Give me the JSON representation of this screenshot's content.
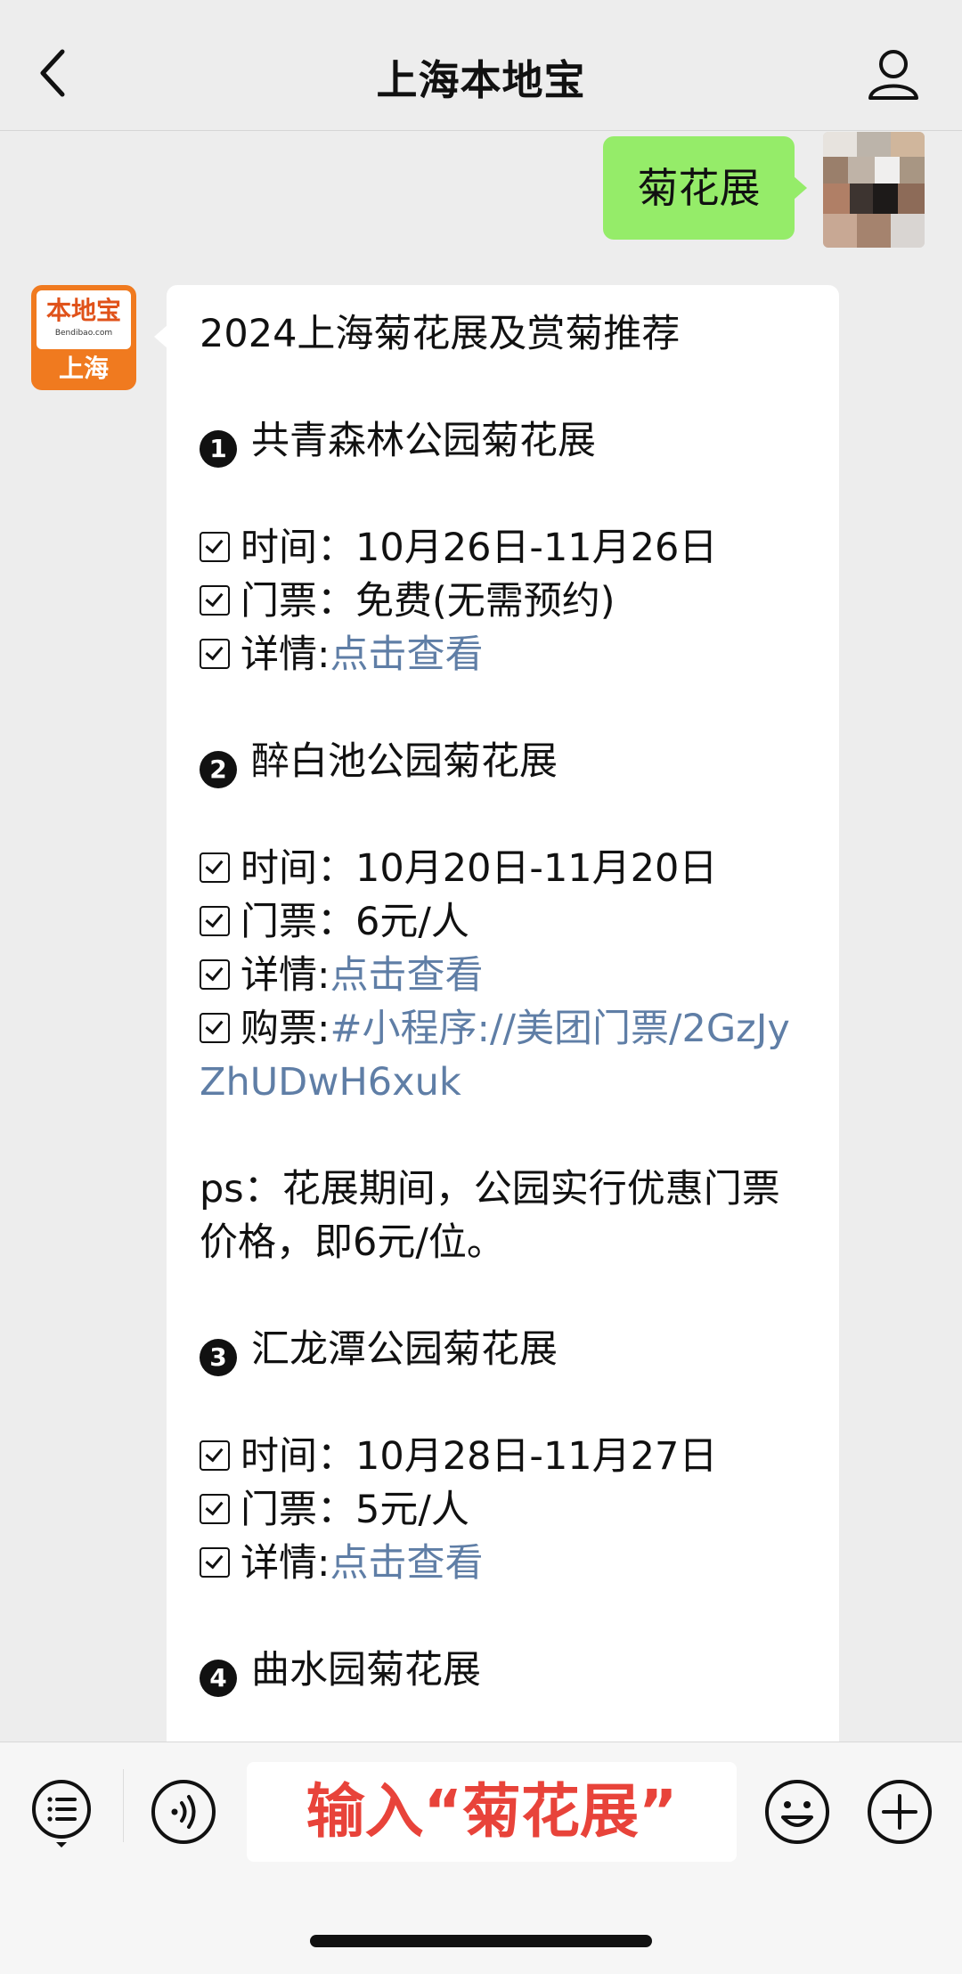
{
  "header": {
    "title": "上海本地宝"
  },
  "user_message": {
    "text": "菊花展"
  },
  "bot": {
    "avatar": {
      "brand": "本地宝",
      "domain": "Bendibao.com",
      "city": "上海"
    },
    "title": "2024上海菊花展及赏菊推荐",
    "sections": [
      {
        "number": "1",
        "name": "共青森林公园菊花展",
        "time": "时间：10月26日-11月26日",
        "ticket": "门票：免费(无需预约)",
        "detail_label": "详情:",
        "detail_link": "点击查看"
      },
      {
        "number": "2",
        "name": "醉白池公园菊花展",
        "time": "时间：10月20日-11月20日",
        "ticket": "门票：6元/人",
        "detail_label": "详情:",
        "detail_link": "点击查看",
        "purchase_label": "购票:",
        "purchase_link": "#小程序://美团门票/2GzJyZhUDwH6xuk",
        "ps": "ps：花展期间，公园实行优惠门票价格，即6元/位。"
      },
      {
        "number": "3",
        "name": "汇龙潭公园菊花展",
        "time": "时间：10月28日-11月27日",
        "ticket": "门票：5元/人",
        "detail_label": "详情:",
        "detail_link": "点击查看"
      },
      {
        "number": "4",
        "name": "曲水园菊花展"
      }
    ]
  },
  "input_bar": {
    "input_text": "输入“菊花展”",
    "icons": [
      "menu-list-icon",
      "voice-icon",
      "emoji-icon",
      "plus-icon"
    ]
  },
  "colors": {
    "user_bubble": "#95ec69",
    "link": "#5f7ea6",
    "input_text": "#e8433a",
    "brand_orange": "#f07a1f"
  }
}
